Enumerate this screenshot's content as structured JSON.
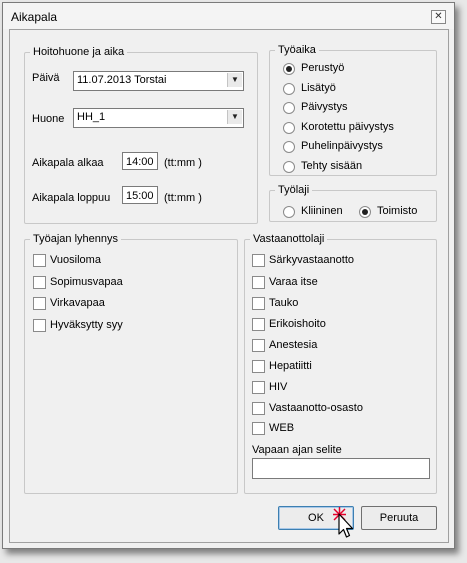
{
  "window": {
    "title": "Aikapala"
  },
  "schedule_group": {
    "legend": "Hoitohuone ja aika",
    "day_label": "Päivä",
    "day_value": "11.07.2013 Torstai",
    "room_label": "Huone",
    "room_value": "HH_1",
    "start_label": "Aikapala alkaa",
    "start_value": "14:00",
    "start_format": "(tt:mm )",
    "end_label": "Aikapala loppuu",
    "end_value": "15:00",
    "end_format": "(tt:mm )"
  },
  "worktime_group": {
    "legend": "Työaika",
    "options": [
      {
        "label": "Perustyö",
        "selected": true
      },
      {
        "label": "Lisätyö",
        "selected": false
      },
      {
        "label": "Päivystys",
        "selected": false
      },
      {
        "label": "Korotettu päivystys",
        "selected": false
      },
      {
        "label": "Puhelinpäivystys",
        "selected": false
      },
      {
        "label": "Tehty sisään",
        "selected": false
      }
    ]
  },
  "worktype_group": {
    "legend": "Työlaji",
    "options": [
      {
        "label": "Kliininen",
        "selected": false
      },
      {
        "label": "Toimisto",
        "selected": true
      }
    ]
  },
  "reduction_group": {
    "legend": "Työajan lyhennys",
    "items": [
      {
        "label": "Vuosiloma",
        "checked": false
      },
      {
        "label": "Sopimusvapaa",
        "checked": false
      },
      {
        "label": "Virkavapaa",
        "checked": false
      },
      {
        "label": "Hyväksytty syy",
        "checked": false
      }
    ]
  },
  "reception_group": {
    "legend": "Vastaanottolaji",
    "items": [
      {
        "label": "Särkyvastaanotto",
        "checked": false
      },
      {
        "label": "Varaa itse",
        "checked": false
      },
      {
        "label": "Tauko",
        "checked": false
      },
      {
        "label": "Erikoishoito",
        "checked": false
      },
      {
        "label": "Anestesia",
        "checked": false
      },
      {
        "label": "Hepatiitti",
        "checked": false
      },
      {
        "label": "HIV",
        "checked": false
      },
      {
        "label": "Vastaanotto-osasto",
        "checked": false
      },
      {
        "label": "WEB",
        "checked": false
      }
    ],
    "free_time_label": "Vapaan ajan selite",
    "free_time_value": ""
  },
  "buttons": {
    "ok": "OK",
    "cancel": "Peruuta"
  },
  "icons": {
    "close": "close-icon",
    "dropdown": "chevron-down-icon",
    "cursor": "mouse-pointer-icon"
  }
}
